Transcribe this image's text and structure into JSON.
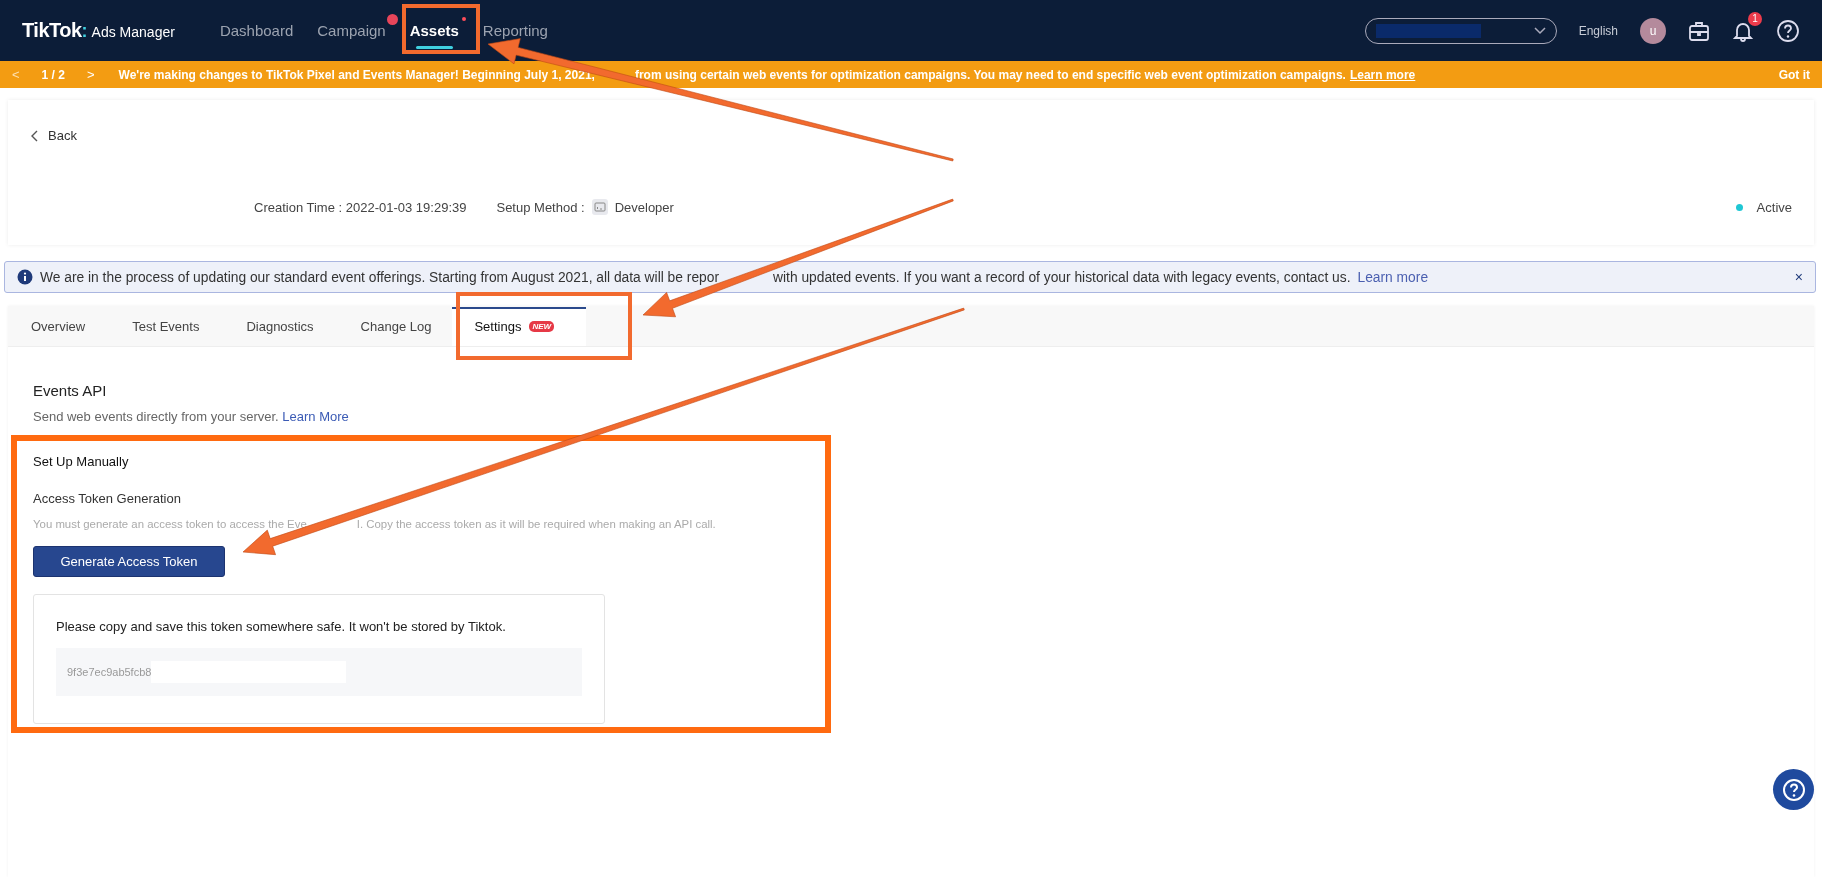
{
  "header": {
    "logo": {
      "brand": "TikTok",
      "separator": ":",
      "product": "Ads Manager"
    },
    "nav": [
      {
        "label": "Dashboard",
        "selected": false,
        "plus_badge": false,
        "dot_badge": false
      },
      {
        "label": "Campaign",
        "selected": false,
        "plus_badge": true,
        "dot_badge": false
      },
      {
        "label": "Assets",
        "selected": true,
        "plus_badge": false,
        "dot_badge": true
      },
      {
        "label": "Reporting",
        "selected": false,
        "plus_badge": false,
        "dot_badge": false
      }
    ],
    "language": "English",
    "avatar": "u",
    "notifications": "1"
  },
  "announcement": {
    "prev": "<",
    "page": "1 / 2",
    "next": ">",
    "text_before": "We're making changes to TikTok Pixel and Events Manager! Beginning **July 1, 2021**, ",
    "text_after": "from using certain web events for optimization campaigns. You may need to end specific web event optimization campaigns.",
    "link": "Learn more",
    "dismiss": "Got it"
  },
  "pixel_card": {
    "back": "Back",
    "creation_time": "Creation Time : 2022-01-03 19:29:39",
    "setup_label": "Setup Method :",
    "setup_value": "Developer",
    "status": "Active",
    "active": true
  },
  "notice": {
    "text_before": "We are in the process of updating our standard event offerings. Starting from August 2021, all data will be repor",
    "text_after": "with updated events. If you want a record of your historical data with legacy events, contact us.",
    "link": "Learn more",
    "close": "×"
  },
  "tabs": [
    {
      "label": "Overview",
      "selected": false
    },
    {
      "label": "Test Events",
      "selected": false
    },
    {
      "label": "Diagnostics",
      "selected": false
    },
    {
      "label": "Change Log",
      "selected": false
    },
    {
      "label": "Settings",
      "selected": true,
      "badge": "NEW"
    }
  ],
  "events_api": {
    "title": "Events API",
    "description": "Send web events directly from your server.",
    "link": "Learn More",
    "manual": {
      "title": "Set Up Manually",
      "subtitle": "Access Token Generation",
      "hint_before": "You must generate an access token to access the Eve",
      "hint_after": "I. Copy the access token as it will be required when making an API call.",
      "button": "Generate Access Token",
      "token_note": "Please copy and save this token somewhere safe. It won't be stored by Tiktok.",
      "token": "9f3e7ec9ab5fcb8"
    }
  }
}
